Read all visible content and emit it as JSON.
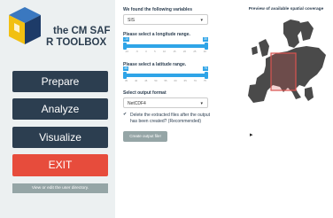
{
  "brand": {
    "line1": "the CM SAF",
    "line2": "R TOOLBOX",
    "colors": {
      "blue": "#2d6fb6",
      "yellow": "#f2c012",
      "navy": "#1d3b68"
    }
  },
  "nav": {
    "prepare": "Prepare",
    "analyze": "Analyze",
    "visualize": "Visualize",
    "exit": "EXIT",
    "view_dir": "View or edit the user directory."
  },
  "form": {
    "variables_label": "We found the following variables",
    "variables_value": "SIS",
    "longitude_label": "Please select a longitude range.",
    "longitude": {
      "min": -10,
      "max": 30,
      "ticks": [
        "-10",
        "-5",
        "0",
        "5",
        "10",
        "15",
        "20",
        "25",
        "30"
      ]
    },
    "latitude_label": "Please select a latitude range.",
    "latitude": {
      "min": 35,
      "max": 75,
      "ticks": [
        "35",
        "40",
        "45",
        "50",
        "55",
        "60",
        "65",
        "70",
        "75"
      ]
    },
    "format_label": "Select output format",
    "format_value": "NetCDF4",
    "delete_label": "Delete the extracted files after the output has been created? (Recommended)",
    "delete_checked": true,
    "create_button": "Create output file!"
  },
  "map": {
    "title": "Preview of available spatial coverage",
    "region_color": "#d9534f"
  },
  "colors": {
    "accent": "#2fa4e7",
    "navy_button": "#2c3e50",
    "exit": "#e74c3c",
    "grey_button": "#95a5a6"
  }
}
